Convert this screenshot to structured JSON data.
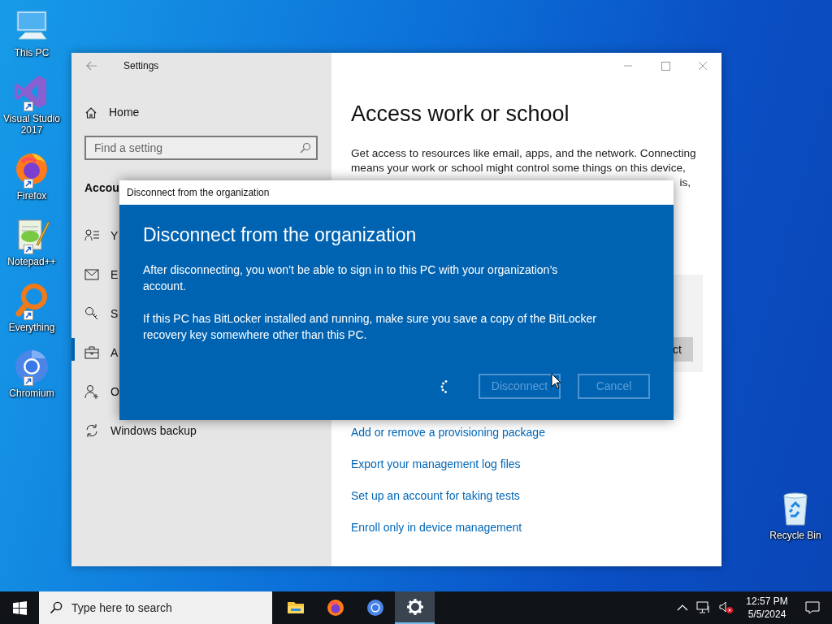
{
  "desktop_icons": [
    {
      "label": "This PC",
      "kind": "pc",
      "shortcut": false
    },
    {
      "label": "Visual Studio 2017",
      "kind": "vs",
      "shortcut": true
    },
    {
      "label": "Firefox",
      "kind": "firefox",
      "shortcut": true
    },
    {
      "label": "Notepad++",
      "kind": "notepad",
      "shortcut": true
    },
    {
      "label": "Everything",
      "kind": "everything",
      "shortcut": true
    },
    {
      "label": "Chromium",
      "kind": "chromium",
      "shortcut": true
    }
  ],
  "recycle_bin": {
    "label": "Recycle Bin",
    "kind": "bin",
    "shortcut": false
  },
  "settings": {
    "title": "Settings",
    "home": "Home",
    "search": {
      "placeholder": "Find a setting"
    },
    "section": "Accou",
    "nav": [
      {
        "label": "Y",
        "kind": "person-list",
        "selected": false
      },
      {
        "label": "E",
        "kind": "mail",
        "selected": false
      },
      {
        "label": "S",
        "kind": "key",
        "selected": false
      },
      {
        "label": "A",
        "kind": "briefcase",
        "selected": true
      },
      {
        "label": "O",
        "kind": "person-add",
        "selected": false
      },
      {
        "label": "Windows backup",
        "kind": "sync",
        "selected": false
      }
    ],
    "heading": "Access work or school",
    "description": "Get access to resources like email, apps, and the network. Connecting means your work or school might control some things on this device,",
    "description_tail": "is,",
    "panel_button": "ct",
    "links": [
      "Add or remove a provisioning package",
      "Export your management log files",
      "Set up an account for taking tests",
      "Enroll only in device management"
    ]
  },
  "dialog": {
    "title": "Disconnect from the organization",
    "heading": "Disconnect from the organization",
    "paragraphs": [
      "After disconnecting, you won’t be able to sign in to this PC with your organization’s account.",
      "If this PC has BitLocker installed and running, make sure you save a copy of the BitLocker recovery key somewhere other than this PC."
    ],
    "busy": true,
    "buttons": [
      {
        "label": "Disconnect",
        "disabled": true
      },
      {
        "label": "Cancel",
        "disabled": true
      }
    ]
  },
  "taskbar": {
    "search": {
      "placeholder": "Type here to search"
    },
    "apps": [
      {
        "kind": "explorer",
        "selected": false
      },
      {
        "kind": "firefox",
        "selected": false
      },
      {
        "kind": "chromium",
        "selected": false
      },
      {
        "kind": "settings",
        "selected": true
      }
    ],
    "time": "12:57 PM",
    "date": "5/5/2024"
  }
}
